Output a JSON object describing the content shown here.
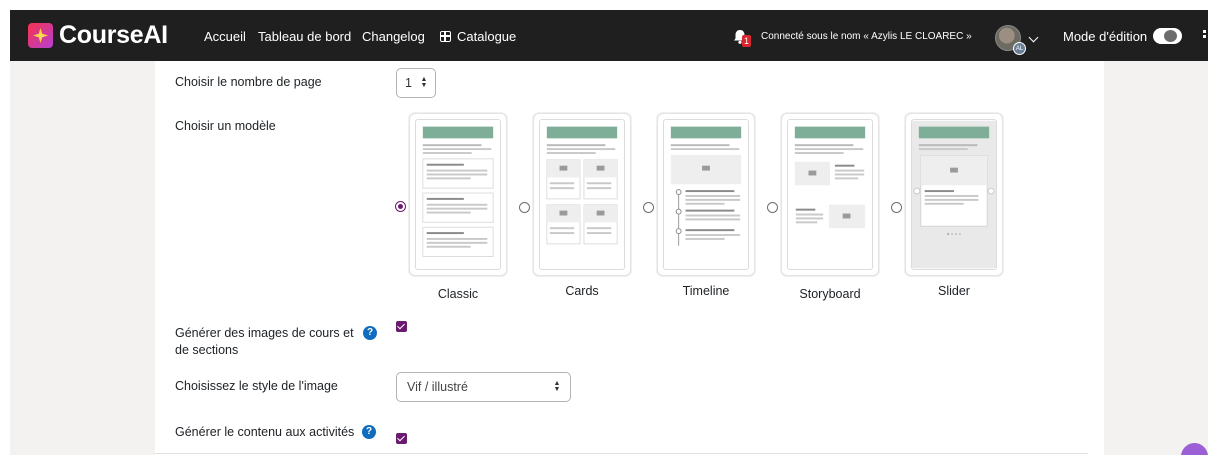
{
  "navbar": {
    "brand": "CourseAI",
    "links": [
      "Accueil",
      "Tableau de bord",
      "Changelog",
      "Catalogue"
    ],
    "notification_count": "1",
    "connected_as": "Connecté sous le nom « Azylis LE CLOAREC »",
    "avatar_initials": "AL",
    "edit_mode_label": "Mode d'édition",
    "edit_mode_on": true
  },
  "form": {
    "page_count": {
      "label": "Choisir le nombre de page",
      "value": "1"
    },
    "template": {
      "label": "Choisir un modèle",
      "options": [
        {
          "name": "Classic",
          "selected": true
        },
        {
          "name": "Cards",
          "selected": false
        },
        {
          "name": "Timeline",
          "selected": false
        },
        {
          "name": "Storyboard",
          "selected": false
        },
        {
          "name": "Slider",
          "selected": false
        }
      ]
    },
    "generate_images": {
      "label_line1": "Générer des images de cours et",
      "label_line2": "de sections",
      "checked": true
    },
    "image_style": {
      "label": "Choisissez le style de l'image",
      "value": "Vif / illustré"
    },
    "generate_content": {
      "label": "Générer le contenu aux activités",
      "checked": true
    }
  },
  "colors": {
    "navbar_bg": "#1f1f1f",
    "accent_purple": "#6a1b6f",
    "help_blue": "#0f6cbf",
    "thumb_header": "#7fae98"
  },
  "icons": [
    "bell-icon",
    "grid-icon",
    "help-icon",
    "apps-icon",
    "chevron-down-icon",
    "image-placeholder-icon"
  ]
}
